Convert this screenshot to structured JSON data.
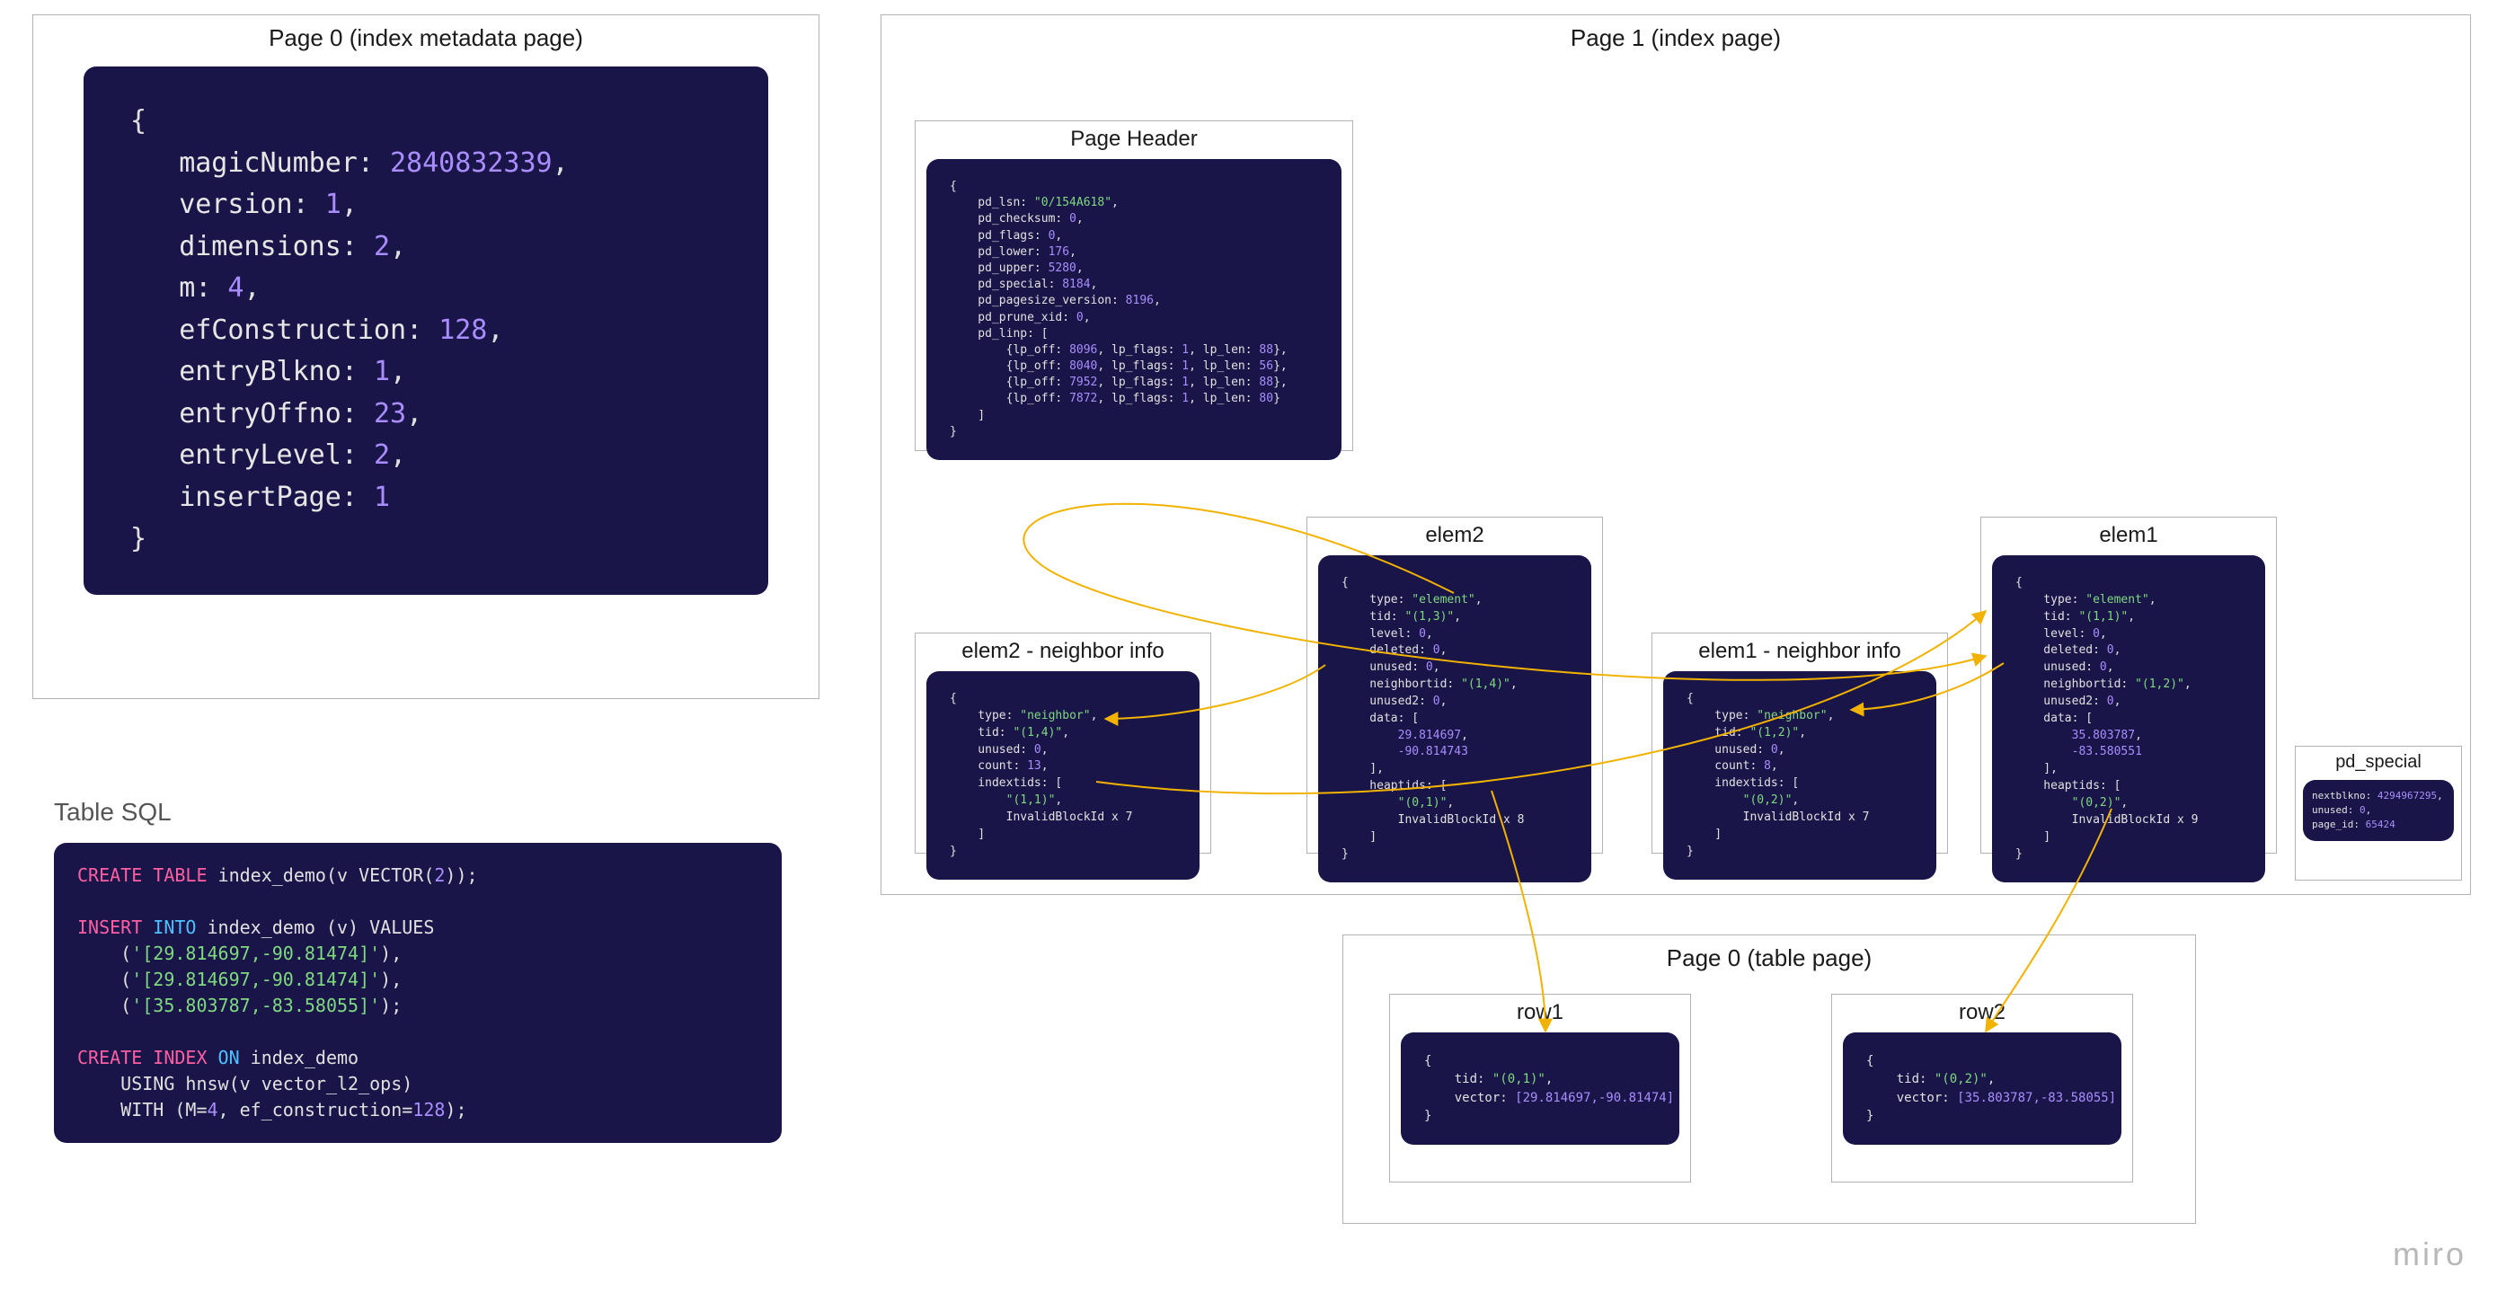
{
  "page0meta": {
    "title": "Page 0 (index metadata page)",
    "fields": {
      "magicNumber": "2840832339",
      "version": "1",
      "dimensions": "2",
      "m": "4",
      "efConstruction": "128",
      "entryBlkno": "1",
      "entryOffno": "23",
      "entryLevel": "2",
      "insertPage": "1"
    }
  },
  "tableSql": {
    "title": "Table SQL",
    "createTable": {
      "kw1": "CREATE TABLE",
      "body": " index_demo(v VECTOR(",
      "num": "2",
      "close": "));"
    },
    "insert": {
      "kw1": "INSERT",
      "kw2": " INTO",
      "body": " index_demo (v) VALUES",
      "rows": [
        "'[29.814697,-90.81474]'",
        "'[29.814697,-90.81474]'",
        "'[35.803787,-83.58055]'"
      ]
    },
    "createIndex": {
      "kw1": "CREATE INDEX",
      "kw2": " ON",
      "body1": " index_demo",
      "line2a": "    USING hnsw(v vector_l2_ops)",
      "line3a": "    WITH (M=",
      "m": "4",
      "line3b": ", ef_construction=",
      "ef": "128",
      "line3c": ");"
    }
  },
  "page1": {
    "title": "Page 1 (index page)",
    "header": {
      "title": "Page Header",
      "pd_lsn": "\"0/154A618\"",
      "pd_checksum": "0",
      "pd_flags": "0",
      "pd_lower": "176",
      "pd_upper": "5280",
      "pd_special": "8184",
      "pd_pagesize_version": "8196",
      "pd_prune_xid": "0",
      "linp": [
        {
          "off": "8096",
          "flags": "1",
          "len": "88"
        },
        {
          "off": "8040",
          "flags": "1",
          "len": "56"
        },
        {
          "off": "7952",
          "flags": "1",
          "len": "88"
        },
        {
          "off": "7872",
          "flags": "1",
          "len": "80"
        }
      ]
    },
    "elem2n": {
      "title": "elem2 - neighbor info",
      "type": "\"neighbor\"",
      "tid": "\"(1,4)\"",
      "unused": "0",
      "count": "13",
      "indextids_first": "\"(1,1)\"",
      "invalid": "InvalidBlockId x 7"
    },
    "elem2": {
      "title": "elem2",
      "type": "\"element\"",
      "tid": "\"(1,3)\"",
      "level": "0",
      "deleted": "0",
      "unused": "0",
      "neighbortid": "\"(1,4)\"",
      "unused2": "0",
      "data": [
        "29.814697",
        "-90.814743"
      ],
      "heaptids_first": "\"(0,1)\"",
      "invalid": "InvalidBlockId x 8"
    },
    "elem1n": {
      "title": "elem1 - neighbor info",
      "type": "\"neighbor\"",
      "tid": "\"(1,2)\"",
      "unused": "0",
      "count": "8",
      "indextids_first": "\"(0,2)\"",
      "invalid": "InvalidBlockId x 7"
    },
    "elem1": {
      "title": "elem1",
      "type": "\"element\"",
      "tid": "\"(1,1)\"",
      "level": "0",
      "deleted": "0",
      "unused": "0",
      "neighbortid": "\"(1,2)\"",
      "unused2": "0",
      "data": [
        "35.803787",
        "-83.580551"
      ],
      "heaptids_first": "\"(0,2)\"",
      "invalid": "InvalidBlockId x 9"
    },
    "pd_special": {
      "title": "pd_special",
      "nextblkno": "4294967295",
      "unused": "0",
      "page_id": "65424"
    }
  },
  "tablePage": {
    "title": "Page 0 (table page)",
    "row1": {
      "title": "row1",
      "tid": "\"(0,1)\"",
      "vector": "[29.814697,-90.81474]"
    },
    "row2": {
      "title": "row2",
      "tid": "\"(0,2)\"",
      "vector": "[35.803787,-83.58055]"
    }
  },
  "watermark": "miro"
}
